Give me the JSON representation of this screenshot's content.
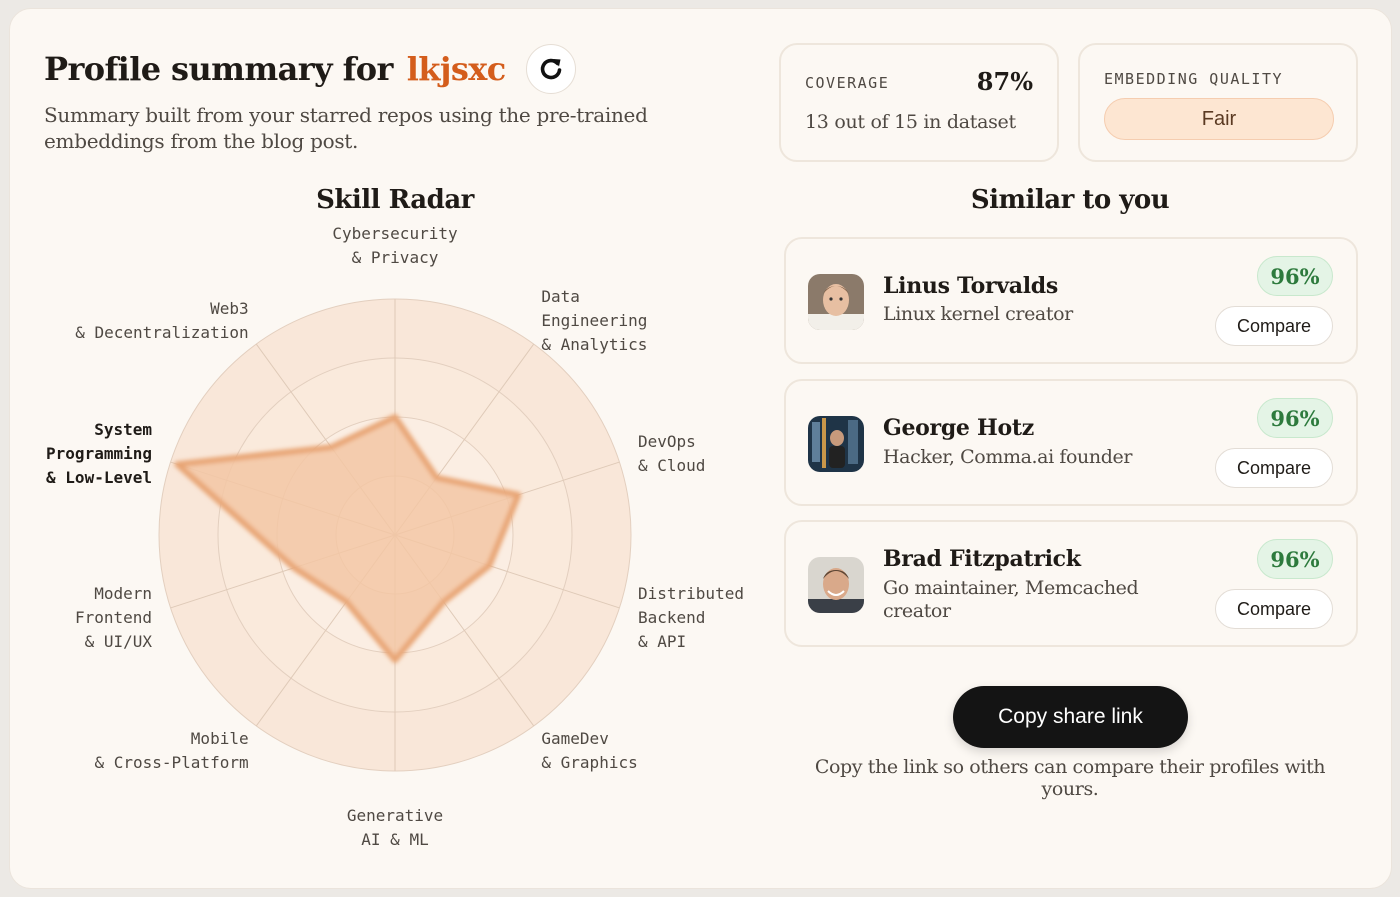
{
  "header": {
    "title": "Profile summary for",
    "username": "lkjsxc",
    "subtitle": "Summary built from your starred repos using the pre-trained embeddings from the blog post.",
    "refresh_icon": "refresh-icon"
  },
  "coverage": {
    "label": "COVERAGE",
    "value": "87%",
    "detail": "13 out of 15 in dataset"
  },
  "quality": {
    "label": "EMBEDDING QUALITY",
    "value": "Fair"
  },
  "radar": {
    "title": "Skill Radar",
    "axes": [
      {
        "lines": [
          "Cybersecurity",
          "& Privacy"
        ],
        "value": 0.5
      },
      {
        "lines": [
          "Data",
          "Engineering",
          "& Analytics"
        ],
        "value": 0.3
      },
      {
        "lines": [
          "DevOps",
          "& Cloud"
        ],
        "value": 0.55
      },
      {
        "lines": [
          "Distributed",
          "Backend",
          "& API"
        ],
        "value": 0.42
      },
      {
        "lines": [
          "GameDev",
          "& Graphics"
        ],
        "value": 0.35
      },
      {
        "lines": [
          "Generative",
          "AI & ML"
        ],
        "value": 0.53
      },
      {
        "lines": [
          "Mobile",
          "& Cross-Platform"
        ],
        "value": 0.35
      },
      {
        "lines": [
          "Modern",
          "Frontend",
          "& UI/UX"
        ],
        "value": 0.45
      },
      {
        "lines": [
          "System",
          "Programming",
          "& Low-Level"
        ],
        "value": 0.97,
        "bold": true
      },
      {
        "lines": [
          "Web3",
          "& Decentralization"
        ],
        "value": 0.46
      }
    ],
    "rings": 4,
    "fill_color": "#f3c7a5",
    "stroke_color": "#e8a575"
  },
  "similar": {
    "title": "Similar to you",
    "compare_label": "Compare",
    "people": [
      {
        "name": "Linus Torvalds",
        "desc": "Linux kernel creator",
        "match": "96%"
      },
      {
        "name": "George Hotz",
        "desc": "Hacker, Comma.ai founder",
        "match": "96%"
      },
      {
        "name": "Brad Fitzpatrick",
        "desc": "Go maintainer, Memcached creator",
        "match": "96%"
      }
    ]
  },
  "share": {
    "button": "Copy share link",
    "hint": "Copy the link so others can compare their profiles with yours."
  }
}
